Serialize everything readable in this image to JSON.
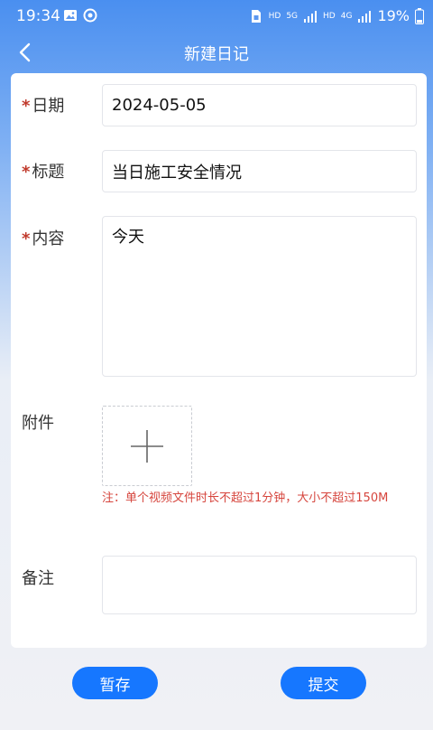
{
  "status_bar": {
    "time": "19:34",
    "net_1": "HD",
    "net_2": "5G",
    "net_3": "HD",
    "net_4": "4G",
    "battery": "19%"
  },
  "nav": {
    "title": "新建日记"
  },
  "form": {
    "date_label": "日期",
    "date_value": "2024-05-05",
    "title_label": "标题",
    "title_value": "当日施工安全情况",
    "content_label": "内容",
    "content_value": "今天",
    "attachment_label": "附件",
    "attachment_note": "注：单个视频文件时长不超过1分钟，大小不超过150M",
    "remark_label": "备注",
    "remark_value": "",
    "required_mark": "*"
  },
  "actions": {
    "draft_label": "暂存",
    "submit_label": "提交"
  },
  "colors": {
    "accent": "#1677ff",
    "required": "#c0392b",
    "note": "#d6453d"
  }
}
